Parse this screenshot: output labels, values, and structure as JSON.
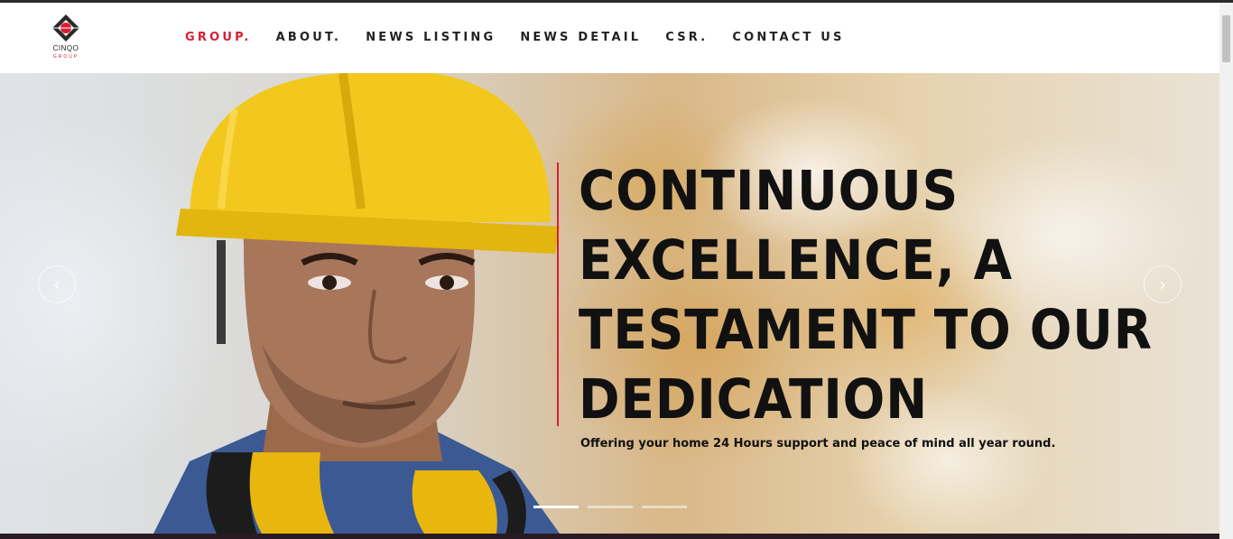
{
  "brand": {
    "logo_text": "CINQO",
    "logo_subtext": "GROUP"
  },
  "nav": {
    "items": [
      {
        "label": "GROUP.",
        "active": true
      },
      {
        "label": "ABOUT.",
        "active": false
      },
      {
        "label": "NEWS LISTING",
        "active": false
      },
      {
        "label": "NEWS DETAIL",
        "active": false
      },
      {
        "label": "CSR.",
        "active": false
      },
      {
        "label": "CONTACT US",
        "active": false
      }
    ]
  },
  "hero": {
    "headline_lines": [
      "CONTINUOUS",
      "EXCELLENCE, A",
      "TESTAMENT TO OUR",
      "DEDICATION"
    ],
    "subtitle": "Offering your home 24 Hours support and peace of mind all year round.",
    "prev_icon": "‹",
    "next_icon": "›",
    "slide_count": 3,
    "active_slide": 1
  },
  "colors": {
    "accent": "#d51f35",
    "text": "#111111",
    "helmet": "#f2c81e"
  }
}
